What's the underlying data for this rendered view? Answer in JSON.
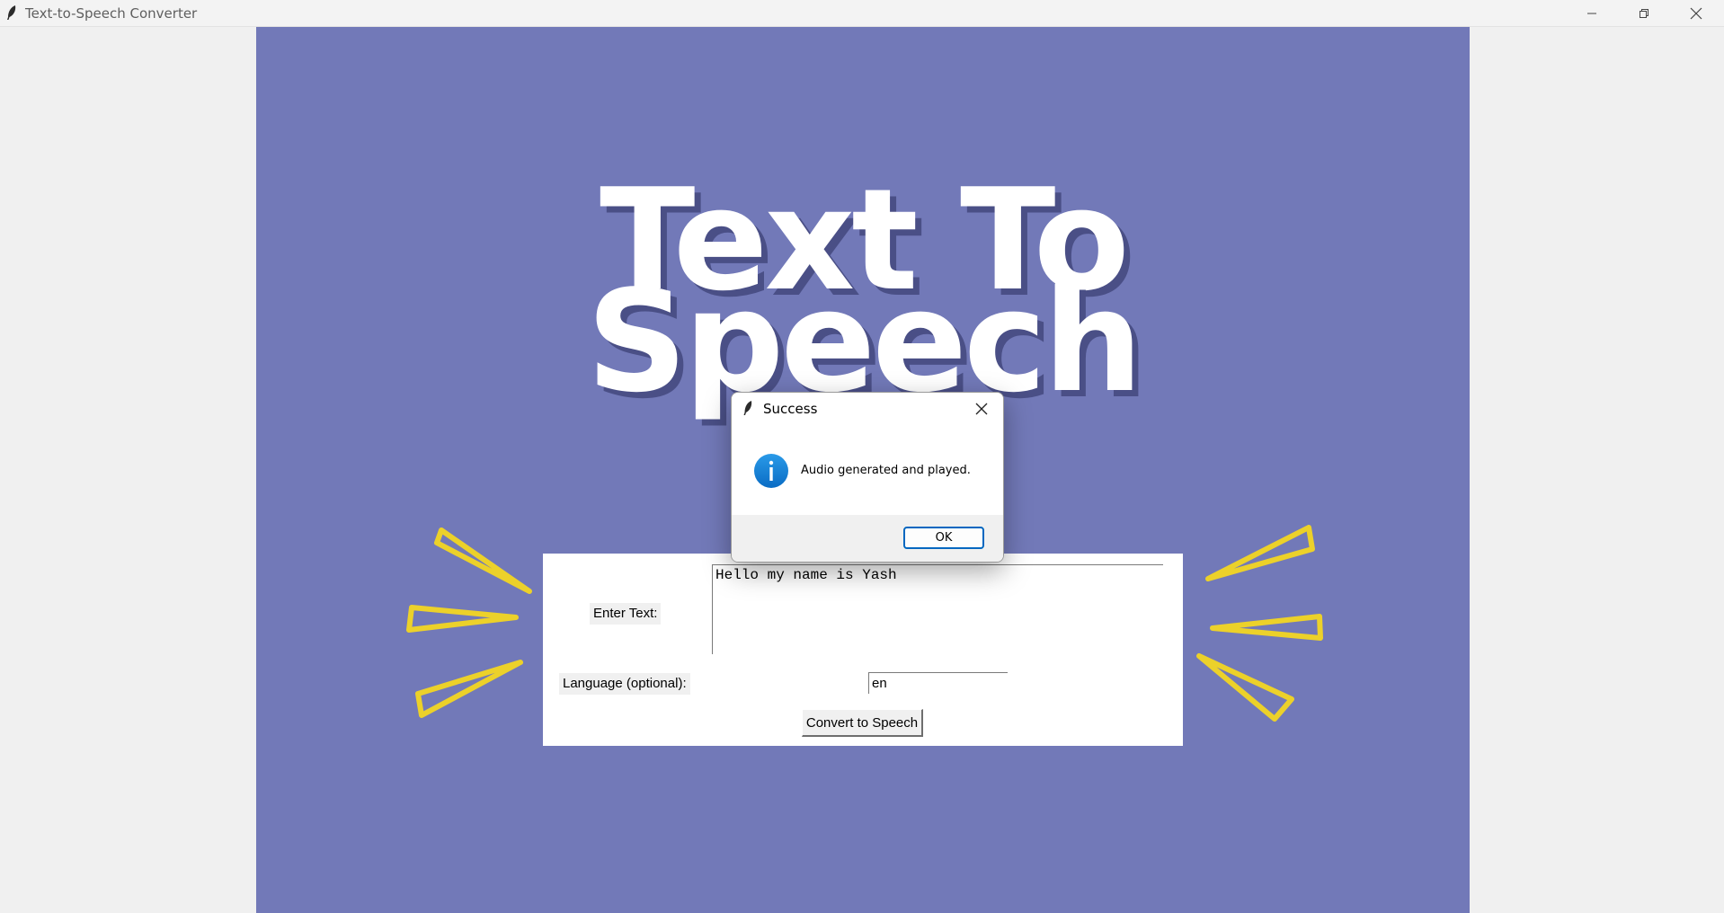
{
  "window": {
    "title": "Text-to-Speech Converter"
  },
  "hero": {
    "line1": "Text To",
    "line2": "Speech"
  },
  "form": {
    "text_label": "Enter Text:",
    "text_value": "Hello my name is Yash",
    "language_label": "Language (optional):",
    "language_value": "en",
    "convert_label": "Convert to Speech"
  },
  "dialog": {
    "title": "Success",
    "message": "Audio generated and played.",
    "ok_label": "OK",
    "icon": "info-icon"
  },
  "colors": {
    "canvas_bg": "#7279b8",
    "accent_yellow": "#ecd12a",
    "title_shadow": "#4a4f86",
    "dialog_accent": "#0067c0"
  }
}
